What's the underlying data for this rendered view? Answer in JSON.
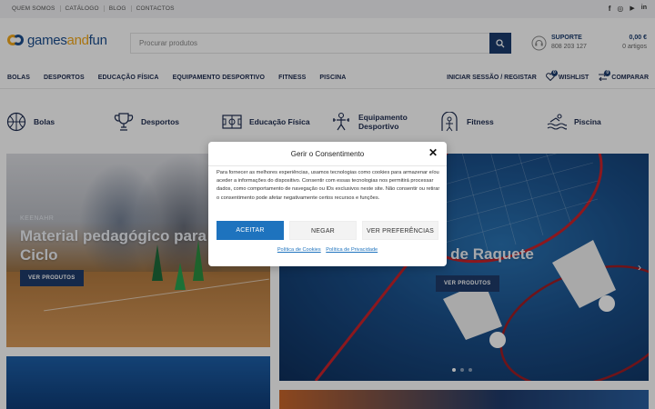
{
  "topbar": {
    "links": [
      "QUEM SOMOS",
      "CATÁLOGO",
      "BLOG",
      "CONTACTOS"
    ],
    "social_icons": [
      "facebook-icon",
      "instagram-icon",
      "youtube-icon",
      "linkedin-icon"
    ],
    "social_glyphs": [
      "f",
      "◎",
      "▶",
      "in"
    ]
  },
  "header": {
    "logo": {
      "part1": "games",
      "part2": "and",
      "part3": "fun"
    },
    "search_placeholder": "Procurar produtos",
    "support": {
      "label": "SUPORTE",
      "phone": "808 203 127"
    },
    "cart": {
      "total": "0,00 €",
      "items": "0 artigos"
    }
  },
  "nav": {
    "items": [
      "BOLAS",
      "DESPORTOS",
      "EDUCAÇÃO FÍSICA",
      "EQUIPAMENTO DESPORTIVO",
      "FITNESS",
      "PISCINA"
    ],
    "login": "INICIAR SESSÃO / REGISTAR",
    "wishlist": "WISHLIST",
    "wishlist_count": "0",
    "compare": "COMPARAR",
    "compare_count": "0"
  },
  "categories": [
    {
      "label": "Bolas",
      "icon": "ball-icon"
    },
    {
      "label": "Desportos",
      "icon": "trophy-icon"
    },
    {
      "label": "Educação Física",
      "icon": "field-icon"
    },
    {
      "label": "Equipamento Desportivo",
      "icon": "equipment-icon"
    },
    {
      "label": "Fitness",
      "icon": "fitness-icon"
    },
    {
      "label": "Piscina",
      "icon": "pool-icon"
    }
  ],
  "hero_left": {
    "tag": "KEENAHR",
    "title_line1": "Material pedagógico para o",
    "title_line2": "Ciclo",
    "button": "VER PRODUTOS"
  },
  "hero_right": {
    "title": "s de Raquete",
    "button": "VER PRODUTOS"
  },
  "consent": {
    "title": "Gerir o Consentimento",
    "body": "Para fornecer as melhores experiências, usamos tecnologias como cookies para armazenar e/ou aceder a informações do dispositivo. Consentir com essas tecnologias nos permitirá processar dados, como comportamento de navegação ou IDs exclusivos neste site. Não consentir ou retirar o consentimento pode afetar negativamente certos recursos e funções.",
    "accept": "ACEITAR",
    "deny": "NEGAR",
    "preferences": "VER PREFERÊNCIAS",
    "cookie_policy": "Política de Cookies",
    "privacy_policy": "Política de Privacidade"
  },
  "colors": {
    "brand_blue": "#1a3c6e",
    "brand_orange": "#f2a81b",
    "accept_button": "#1e73be"
  }
}
